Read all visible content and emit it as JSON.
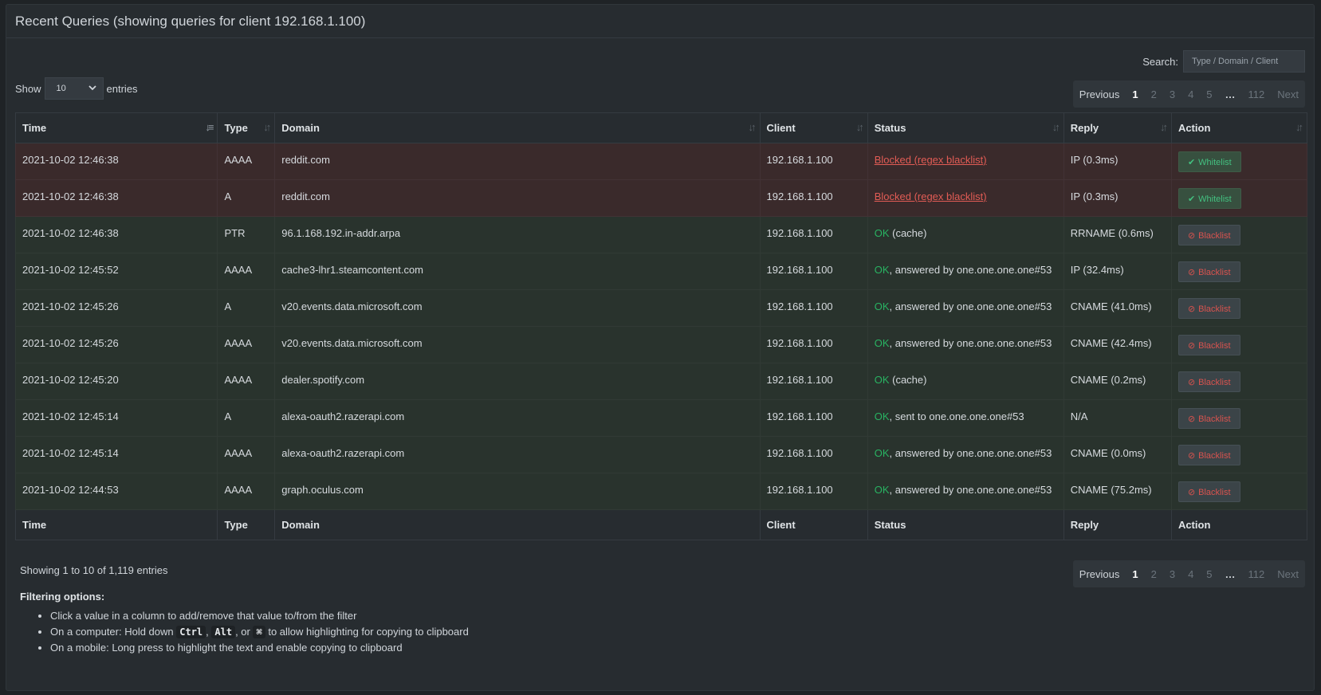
{
  "title": "Recent Queries (showing queries for client 192.168.1.100)",
  "search": {
    "label": "Search:",
    "placeholder": "Type / Domain / Client"
  },
  "length": {
    "show": "Show",
    "value": "10",
    "entries": "entries"
  },
  "pager": {
    "previous": "Previous",
    "pages": [
      "1",
      "2",
      "3",
      "4",
      "5"
    ],
    "ellipsis": "…",
    "last": "112",
    "next": "Next",
    "current": "1"
  },
  "columns": [
    "Time",
    "Type",
    "Domain",
    "Client",
    "Status",
    "Reply",
    "Action"
  ],
  "rows": [
    {
      "time": "2021-10-02 12:46:38",
      "type": "AAAA",
      "domain": "reddit.com",
      "client": "192.168.1.100",
      "status_ok": "",
      "status_rest": "",
      "status_blocked": "Blocked (regex blacklist)",
      "reply": "IP (0.3ms)",
      "action": "Whitelist",
      "kind": "blocked"
    },
    {
      "time": "2021-10-02 12:46:38",
      "type": "A",
      "domain": "reddit.com",
      "client": "192.168.1.100",
      "status_ok": "",
      "status_rest": "",
      "status_blocked": "Blocked (regex blacklist)",
      "reply": "IP (0.3ms)",
      "action": "Whitelist",
      "kind": "blocked"
    },
    {
      "time": "2021-10-02 12:46:38",
      "type": "PTR",
      "domain": "96.1.168.192.in-addr.arpa",
      "client": "192.168.1.100",
      "status_ok": "OK",
      "status_rest": " (cache)",
      "status_blocked": "",
      "reply": "RRNAME (0.6ms)",
      "action": "Blacklist",
      "kind": "allowed"
    },
    {
      "time": "2021-10-02 12:45:52",
      "type": "AAAA",
      "domain": "cache3-lhr1.steamcontent.com",
      "client": "192.168.1.100",
      "status_ok": "OK",
      "status_rest": ", answered by one.one.one.one#53",
      "status_blocked": "",
      "reply": "IP (32.4ms)",
      "action": "Blacklist",
      "kind": "allowed"
    },
    {
      "time": "2021-10-02 12:45:26",
      "type": "A",
      "domain": "v20.events.data.microsoft.com",
      "client": "192.168.1.100",
      "status_ok": "OK",
      "status_rest": ", answered by one.one.one.one#53",
      "status_blocked": "",
      "reply": "CNAME (41.0ms)",
      "action": "Blacklist",
      "kind": "allowed"
    },
    {
      "time": "2021-10-02 12:45:26",
      "type": "AAAA",
      "domain": "v20.events.data.microsoft.com",
      "client": "192.168.1.100",
      "status_ok": "OK",
      "status_rest": ", answered by one.one.one.one#53",
      "status_blocked": "",
      "reply": "CNAME (42.4ms)",
      "action": "Blacklist",
      "kind": "allowed"
    },
    {
      "time": "2021-10-02 12:45:20",
      "type": "AAAA",
      "domain": "dealer.spotify.com",
      "client": "192.168.1.100",
      "status_ok": "OK",
      "status_rest": " (cache)",
      "status_blocked": "",
      "reply": "CNAME (0.2ms)",
      "action": "Blacklist",
      "kind": "allowed"
    },
    {
      "time": "2021-10-02 12:45:14",
      "type": "A",
      "domain": "alexa-oauth2.razerapi.com",
      "client": "192.168.1.100",
      "status_ok": "OK",
      "status_rest": ", sent to one.one.one.one#53",
      "status_blocked": "",
      "reply": "N/A",
      "action": "Blacklist",
      "kind": "allowed"
    },
    {
      "time": "2021-10-02 12:45:14",
      "type": "AAAA",
      "domain": "alexa-oauth2.razerapi.com",
      "client": "192.168.1.100",
      "status_ok": "OK",
      "status_rest": ", answered by one.one.one.one#53",
      "status_blocked": "",
      "reply": "CNAME (0.0ms)",
      "action": "Blacklist",
      "kind": "allowed"
    },
    {
      "time": "2021-10-02 12:44:53",
      "type": "AAAA",
      "domain": "graph.oculus.com",
      "client": "192.168.1.100",
      "status_ok": "OK",
      "status_rest": ", answered by one.one.one.one#53",
      "status_blocked": "",
      "reply": "CNAME (75.2ms)",
      "action": "Blacklist",
      "kind": "allowed"
    }
  ],
  "info": "Showing 1 to 10 of 1,119 entries",
  "filtering": {
    "title": "Filtering options:",
    "tip1": "Click a value in a column to add/remove that value to/from the filter",
    "tip2_a": "On a computer: Hold down ",
    "tip2_ctrl": "Ctrl",
    "tip2_sep": ", ",
    "tip2_alt": "Alt",
    "tip2_or": ", or ",
    "tip2_cmd": "⌘",
    "tip2_b": " to allow highlighting for copying to clipboard",
    "tip3": "On a mobile: Long press to highlight the text and enable copying to clipboard"
  },
  "icons": {
    "sort": "sort-icon",
    "whitelist": "check-icon",
    "blacklist": "ban-icon"
  },
  "colors": {
    "ok": "#29b362",
    "blocked": "#e25c55",
    "whitelist_btn": "#43c080",
    "blacklist_btn": "#d9534f"
  }
}
